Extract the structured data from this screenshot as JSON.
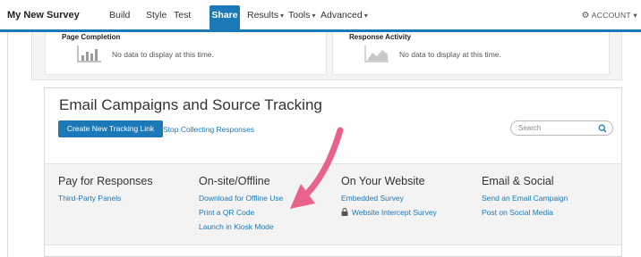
{
  "header": {
    "survey_title": "My New Survey",
    "nav": [
      {
        "label": "Build",
        "dropdown": false
      },
      {
        "label": "Style",
        "dropdown": false
      },
      {
        "label": "Test",
        "dropdown": false
      },
      {
        "label": "Share",
        "dropdown": false,
        "active": true
      },
      {
        "label": "Results",
        "dropdown": true
      },
      {
        "label": "Tools",
        "dropdown": true
      },
      {
        "label": "Advanced",
        "dropdown": true
      }
    ],
    "account_label": "ACCOUNT",
    "accent_color": "#1b79b7"
  },
  "top_cards": [
    {
      "title": "Page Completion",
      "message": "No data to display at this time.",
      "icon": "bar-chart-icon"
    },
    {
      "title": "Response Activity",
      "message": "No data to display at this time.",
      "icon": "area-chart-icon"
    }
  ],
  "email_panel": {
    "title": "Email Campaigns and Source Tracking",
    "create_button": "Create New Tracking Link",
    "stop_link": "Stop Collecting Responses",
    "search_placeholder": "Search",
    "columns": [
      {
        "heading": "Pay for Responses",
        "links": [
          "Third-Party Panels"
        ]
      },
      {
        "heading": "On-site/Offline",
        "links": [
          "Download for Offline Use",
          "Print a QR Code",
          "Launch in Kiosk Mode"
        ]
      },
      {
        "heading": "On Your Website",
        "links": [
          "Embedded Survey",
          "Website Intercept Survey"
        ]
      },
      {
        "heading": "Email & Social",
        "links": [
          "Send an Email Campaign",
          "Post on Social Media"
        ]
      }
    ]
  },
  "annotation": {
    "arrow_color": "#e8628a",
    "points_to": "Download for Offline Use"
  }
}
